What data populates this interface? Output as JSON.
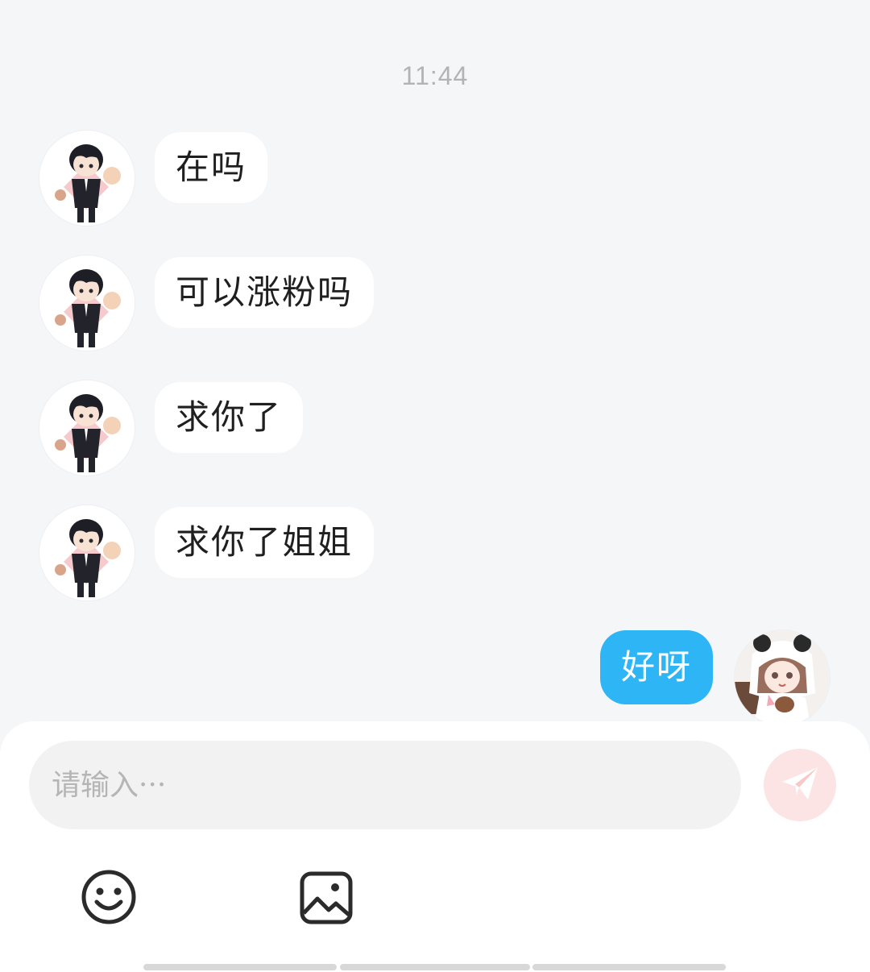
{
  "chat": {
    "timestamp": "11:44",
    "messages": [
      {
        "direction": "incoming",
        "text": "在吗"
      },
      {
        "direction": "incoming",
        "text": "可以涨粉吗"
      },
      {
        "direction": "incoming",
        "text": "求你了"
      },
      {
        "direction": "incoming",
        "text": "求你了姐姐"
      },
      {
        "direction": "outgoing",
        "text": "好呀"
      }
    ]
  },
  "composer": {
    "input_placeholder": "请输入···",
    "input_value": "",
    "send_icon": "paper-plane-icon",
    "tools": [
      {
        "icon": "emoji-icon"
      },
      {
        "icon": "image-icon"
      }
    ]
  },
  "colors": {
    "background": "#f5f6f8",
    "incoming_bubble": "#ffffff",
    "outgoing_bubble": "#2db5f5",
    "send_button": "#fde4e4",
    "timestamp": "#b3b3b3"
  }
}
